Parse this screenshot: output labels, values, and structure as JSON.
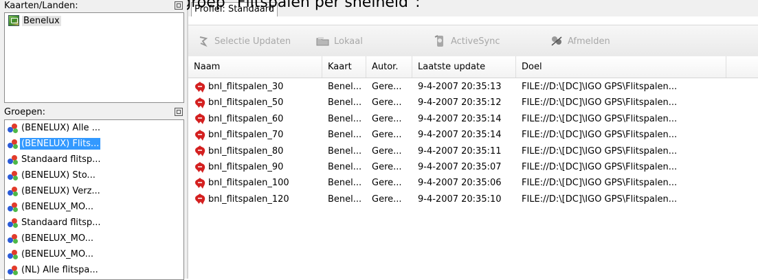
{
  "heading": "Selecteer als eerste de groep \"Flitspalen per snelheid\":",
  "kaarten_panel": {
    "title": "Kaarten/Landen:",
    "items": [
      {
        "label": "Benelux",
        "icon": "map-icon"
      }
    ]
  },
  "groepen_panel": {
    "title": "Groepen:",
    "items": [
      {
        "label": "(BENELUX) Alle ...",
        "selected": false
      },
      {
        "label": "(BENELUX) Flits...",
        "selected": true
      },
      {
        "label": "Standaard flitsp...",
        "selected": false
      },
      {
        "label": "(BENELUX) Sto...",
        "selected": false
      },
      {
        "label": "(BENELUX) Verz...",
        "selected": false
      },
      {
        "label": "(BENELUX_MO...",
        "selected": false
      },
      {
        "label": "Standaard flitsp...",
        "selected": false
      },
      {
        "label": "(BENELUX_MO...",
        "selected": false
      },
      {
        "label": "(BENELUX_MO...",
        "selected": false
      },
      {
        "label": "(NL) Alle flitspa...",
        "selected": false
      }
    ]
  },
  "profile_tab": {
    "prefix": "Profiel:",
    "value": "Standaard"
  },
  "toolbar": {
    "buttons": [
      {
        "label": "Selectie Updaten",
        "icon": "update-icon"
      },
      {
        "label": "Lokaal",
        "icon": "folder-icon"
      },
      {
        "label": "ActiveSync",
        "icon": "activesync-icon"
      },
      {
        "label": "Afmelden",
        "icon": "logout-icon"
      }
    ]
  },
  "table": {
    "columns": [
      "Naam",
      "Kaart",
      "Autor.",
      "Laatste update",
      "Doel"
    ],
    "rows": [
      {
        "naam": "bnl_flitspalen_30",
        "kaart": "Benel...",
        "autor": "Gere...",
        "update": "9-4-2007 20:35:13",
        "doel": "FILE://D:\\[DC]\\IGO GPS\\Flitspalen..."
      },
      {
        "naam": "bnl_flitspalen_50",
        "kaart": "Benel...",
        "autor": "Gere...",
        "update": "9-4-2007 20:35:12",
        "doel": "FILE://D:\\[DC]\\IGO GPS\\Flitspalen..."
      },
      {
        "naam": "bnl_flitspalen_60",
        "kaart": "Benel...",
        "autor": "Gere...",
        "update": "9-4-2007 20:35:14",
        "doel": "FILE://D:\\[DC]\\IGO GPS\\Flitspalen..."
      },
      {
        "naam": "bnl_flitspalen_70",
        "kaart": "Benel...",
        "autor": "Gere...",
        "update": "9-4-2007 20:35:14",
        "doel": "FILE://D:\\[DC]\\IGO GPS\\Flitspalen..."
      },
      {
        "naam": "bnl_flitspalen_80",
        "kaart": "Benel...",
        "autor": "Gere...",
        "update": "9-4-2007 20:35:11",
        "doel": "FILE://D:\\[DC]\\IGO GPS\\Flitspalen..."
      },
      {
        "naam": "bnl_flitspalen_90",
        "kaart": "Benel...",
        "autor": "Gere...",
        "update": "9-4-2007 20:35:07",
        "doel": "FILE://D:\\[DC]\\IGO GPS\\Flitspalen..."
      },
      {
        "naam": "bnl_flitspalen_100",
        "kaart": "Benel...",
        "autor": "Gere...",
        "update": "9-4-2007 20:35:06",
        "doel": "FILE://D:\\[DC]\\IGO GPS\\Flitspalen..."
      },
      {
        "naam": "bnl_flitspalen_120",
        "kaart": "Benel...",
        "autor": "Gere...",
        "update": "9-4-2007 20:35:10",
        "doel": "FILE://D:\\[DC]\\IGO GPS\\Flitspalen..."
      }
    ]
  },
  "colors": {
    "selection": "#3399ff",
    "item_icon": "#d42020",
    "disabled_text": "#a8a8a8"
  }
}
